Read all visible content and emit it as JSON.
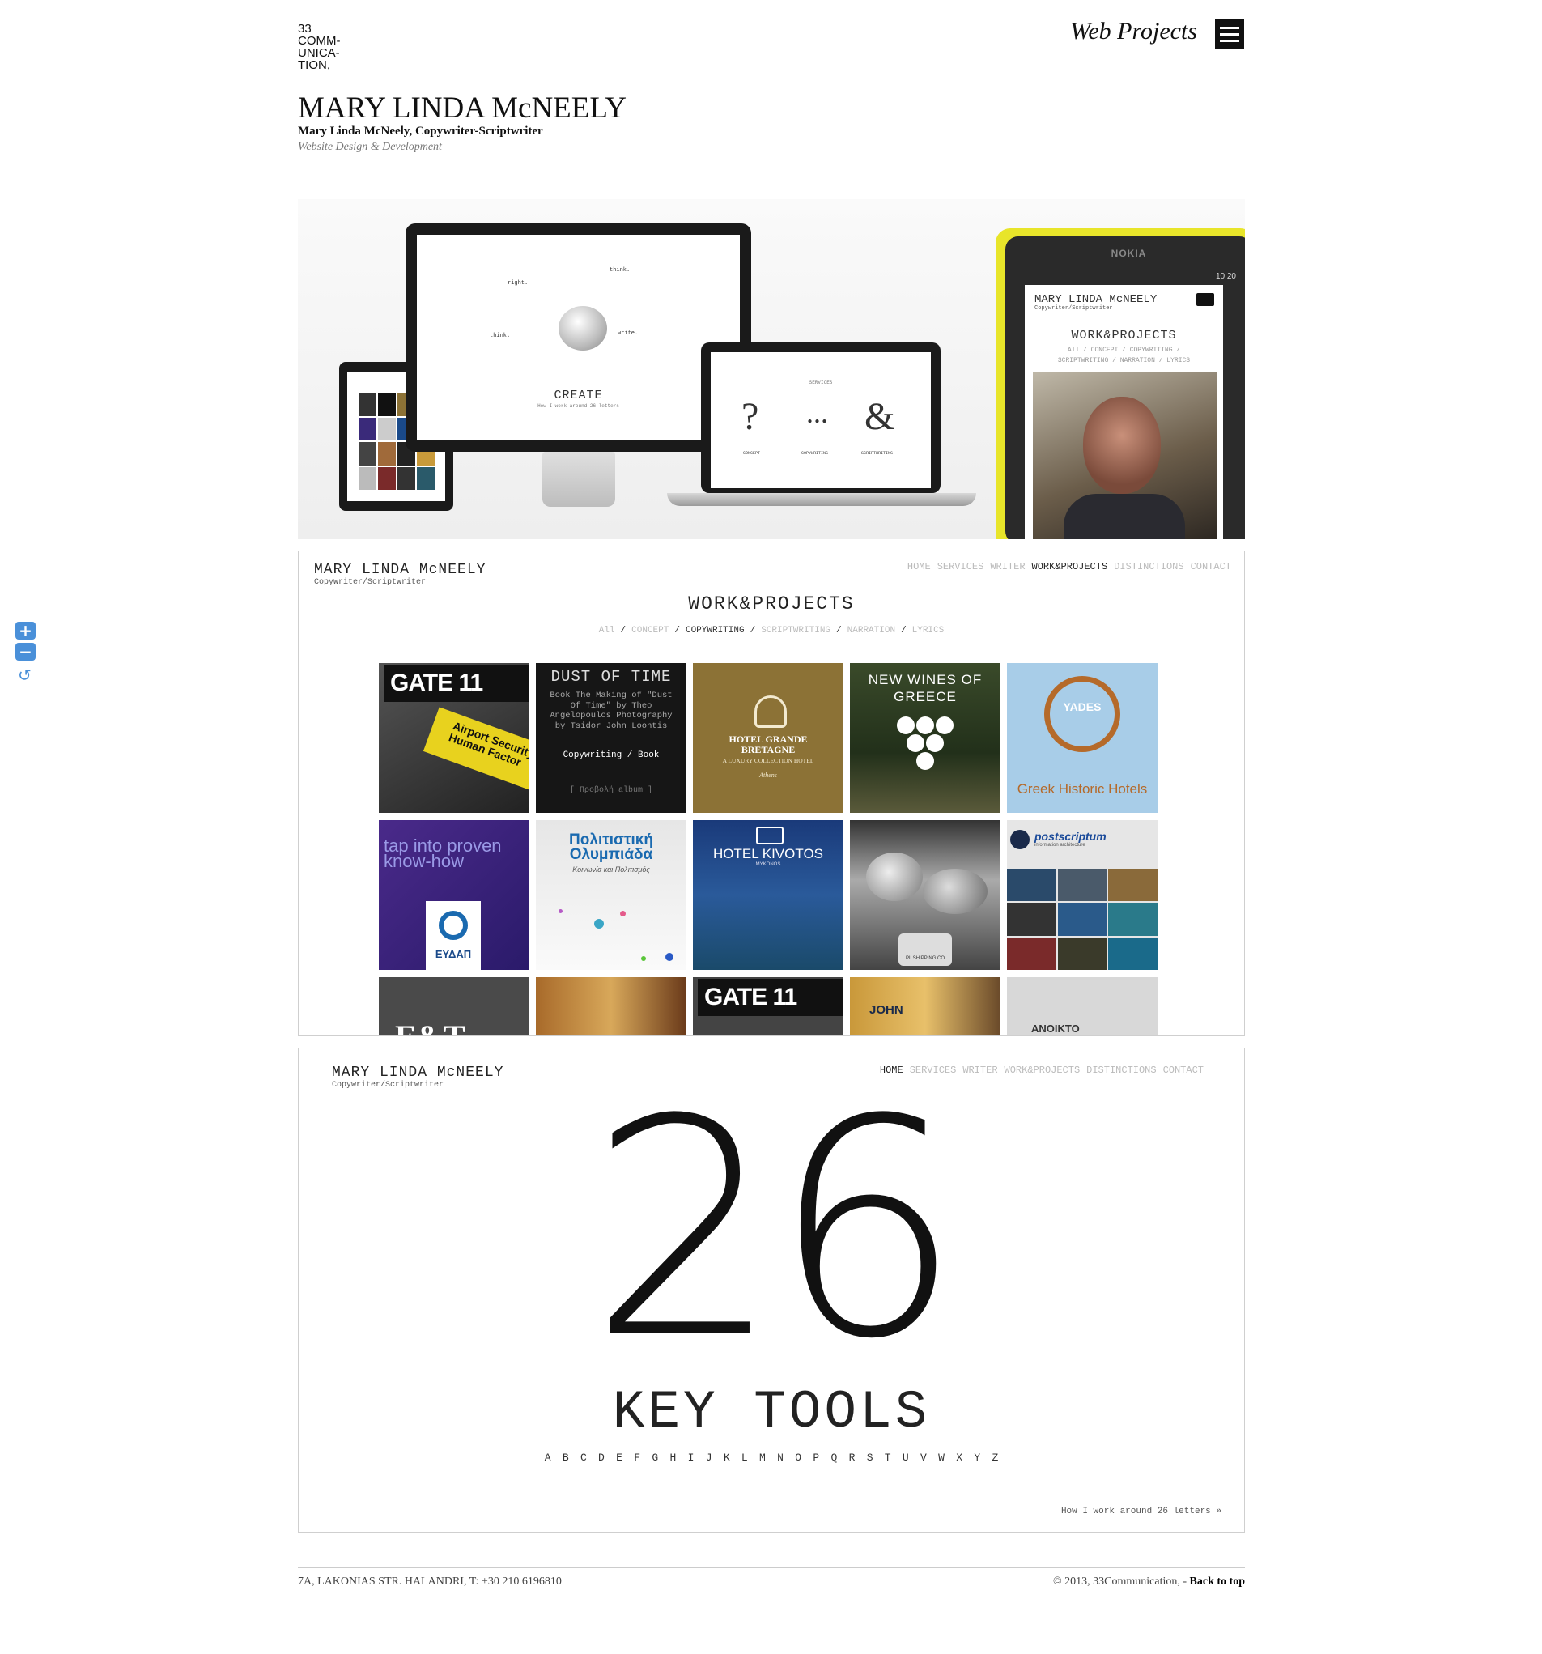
{
  "brand": {
    "logo_lines": [
      "33",
      "COMM-",
      "UNICA-",
      "TION,"
    ]
  },
  "header": {
    "page_label": "Web Projects"
  },
  "project": {
    "title": "MARY LINDA McNEELY",
    "subtitle": "Mary Linda McNeely, Copywriter-Scriptwriter",
    "tagline": "Website Design & Development"
  },
  "hero": {
    "monitor_heading": "CREATE",
    "monitor_sub": "How I work around 26 letters",
    "monitor_words": [
      "right.",
      "think.",
      "think.",
      "write."
    ],
    "laptop_heading": "SERVICES",
    "laptop_symbols": [
      "?",
      "...",
      "&"
    ],
    "laptop_labels": [
      "CONCEPT",
      "COPYWRITING",
      "SCRIPTWRITING"
    ],
    "phone_brand": "NOKIA",
    "phone_time": "10:20",
    "phone_site_name": "MARY LINDA McNEELY",
    "phone_site_role": "Copywriter/Scriptwriter",
    "phone_heading": "WORK&PROJECTS",
    "phone_filters_1": "All / CONCEPT / COPYWRITING /",
    "phone_filters_2": "SCRIPTWRITING / NARRATION / LYRICS"
  },
  "site": {
    "name": "MARY LINDA McNEELY",
    "role": "Copywriter/Scriptwriter",
    "nav": [
      "HOME",
      "SERVICES",
      "WRITER",
      "WORK&PROJECTS",
      "DISTINCTIONS",
      "CONTACT"
    ]
  },
  "works": {
    "heading": "WORK&PROJECTS",
    "filters": [
      "All",
      "CONCEPT",
      "COPYWRITING",
      "SCRIPTWRITING",
      "NARRATION",
      "LYRICS"
    ],
    "active_filter": "COPYWRITING",
    "tiles": {
      "gate11": {
        "logo": "GATE 11",
        "sign": "Airport Security The Human Factor"
      },
      "dust": {
        "title": "DUST OF TIME",
        "body": "Book The Making of \"Dust Of Time\" by Theo Angelopoulos Photography by Tsidor John Loontis",
        "tag": "Copywriting / Book",
        "link": "[ Προβολή album ]"
      },
      "hotel": {
        "name": "HOTEL GRANDE BRETAGNE",
        "desc": "A LUXURY COLLECTION HOTEL",
        "city": "Athens"
      },
      "wines": {
        "title": "NEW WINES OF GREECE"
      },
      "yades": {
        "badge": "YADES",
        "caption": "Greek Historic Hotels"
      },
      "eydap": {
        "line": "tap into proven know-how",
        "logo": "ΕΥΔΑΠ"
      },
      "olympiad": {
        "title": "Πολιτιστική Ολυμπιάδα",
        "sub": "Κοινωνία και Πολιτισμός"
      },
      "kivotos": {
        "name": "HOTEL KIVOTOS",
        "place": "MYKONOS"
      },
      "shipping": {
        "name": "PL SHIPPING CO"
      },
      "postscriptum": {
        "name": "postscriptum",
        "sub": "information architecture"
      },
      "row3": {
        "et": "E&T",
        "gate": "GATE 11",
        "john": "JOHN",
        "anoikto": "ANOIKTO"
      }
    }
  },
  "home": {
    "big_number": "26",
    "key_tools": "KEY TOOLS",
    "letters": [
      "A",
      "B",
      "C",
      "D",
      "E",
      "F",
      "G",
      "H",
      "I",
      "J",
      "K",
      "L",
      "M",
      "N",
      "O",
      "P",
      "Q",
      "R",
      "S",
      "T",
      "U",
      "V",
      "W",
      "X",
      "Y",
      "Z"
    ],
    "more_link": "How I work around 26 letters »"
  },
  "footer": {
    "address": "7A, LAKONIAS STR. HALANDRI, T: +30 210 6196810",
    "copyright": "© 2013, 33Communication, -",
    "back_to_top": "Back to top"
  },
  "zoom": {
    "in_icon": "plus-icon",
    "out_icon": "minus-icon",
    "reset_icon": "reset-icon"
  },
  "colors": {
    "accent": "#4a90d9",
    "text": "#111111",
    "muted": "#bbbbbb",
    "gold": "#8c7236",
    "nokia_yellow": "#e8e52a"
  }
}
